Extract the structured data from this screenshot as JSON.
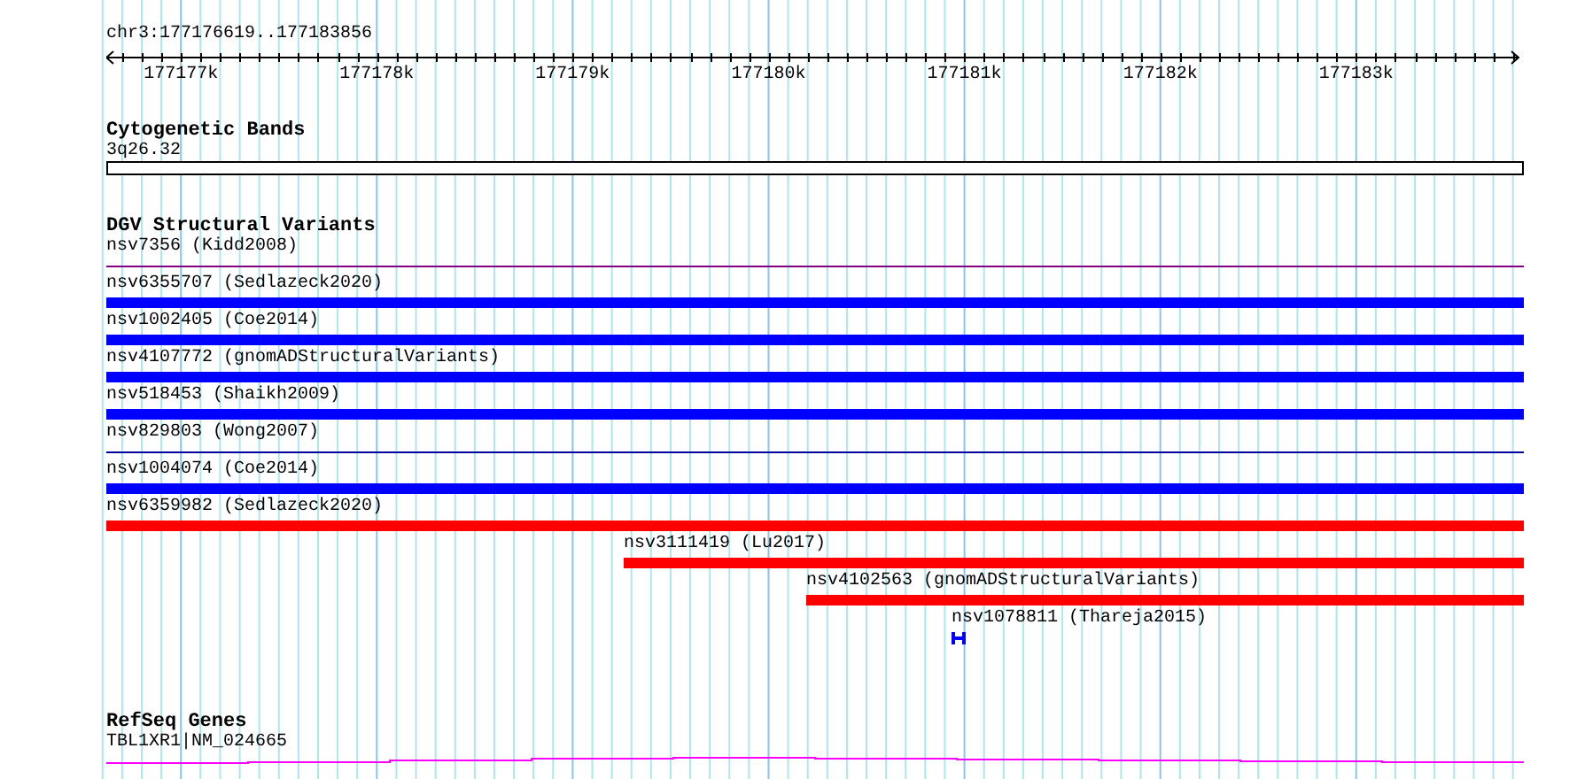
{
  "ruler": {
    "range_label": "chr3:177176619..177183856",
    "tick_labels": [
      "177177k",
      "177178k",
      "177179k",
      "177180k",
      "177181k",
      "177182k",
      "177183k"
    ]
  },
  "tracks": [
    {
      "kind": "bands",
      "title": "Cytogenetic Bands",
      "features": [
        {
          "kind": "band",
          "label": "3q26.32",
          "color": "#ffffff"
        }
      ]
    },
    {
      "kind": "variants",
      "title": "DGV Structural Variants",
      "features": [
        {
          "kind": "line",
          "label": "nsv7356 (Kidd2008)",
          "color": "#800080"
        },
        {
          "kind": "bar",
          "label": "nsv6355707 (Sedlazeck2020)",
          "color": "#0000ff"
        },
        {
          "kind": "bar",
          "label": "nsv1002405 (Coe2014)",
          "color": "#0000ff"
        },
        {
          "kind": "bar",
          "label": "nsv4107772 (gnomADStructuralVariants)",
          "color": "#0000ff"
        },
        {
          "kind": "bar",
          "label": "nsv518453 (Shaikh2009)",
          "color": "#0000ff"
        },
        {
          "kind": "line",
          "label": "nsv829803 (Wong2007)",
          "color": "#0000a0"
        },
        {
          "kind": "bar",
          "label": "nsv1004074 (Coe2014)",
          "color": "#0000ff"
        },
        {
          "kind": "bar",
          "label": "nsv6359982 (Sedlazeck2020)",
          "color": "#ff0000"
        },
        {
          "kind": "bar",
          "label": "nsv3111419 (Lu2017)",
          "color": "#ff0000"
        },
        {
          "kind": "bar",
          "label": "nsv4102563 (gnomADStructuralVariants)",
          "color": "#ff0000"
        },
        {
          "kind": "interval",
          "label": "nsv1078811 (Thareja2015)",
          "color": "#0000ff"
        }
      ]
    },
    {
      "kind": "genes",
      "title": "RefSeq Genes",
      "features": [
        {
          "kind": "gene",
          "label": "TBL1XR1|NM_024665",
          "color": "#ff00ff"
        }
      ]
    }
  ]
}
